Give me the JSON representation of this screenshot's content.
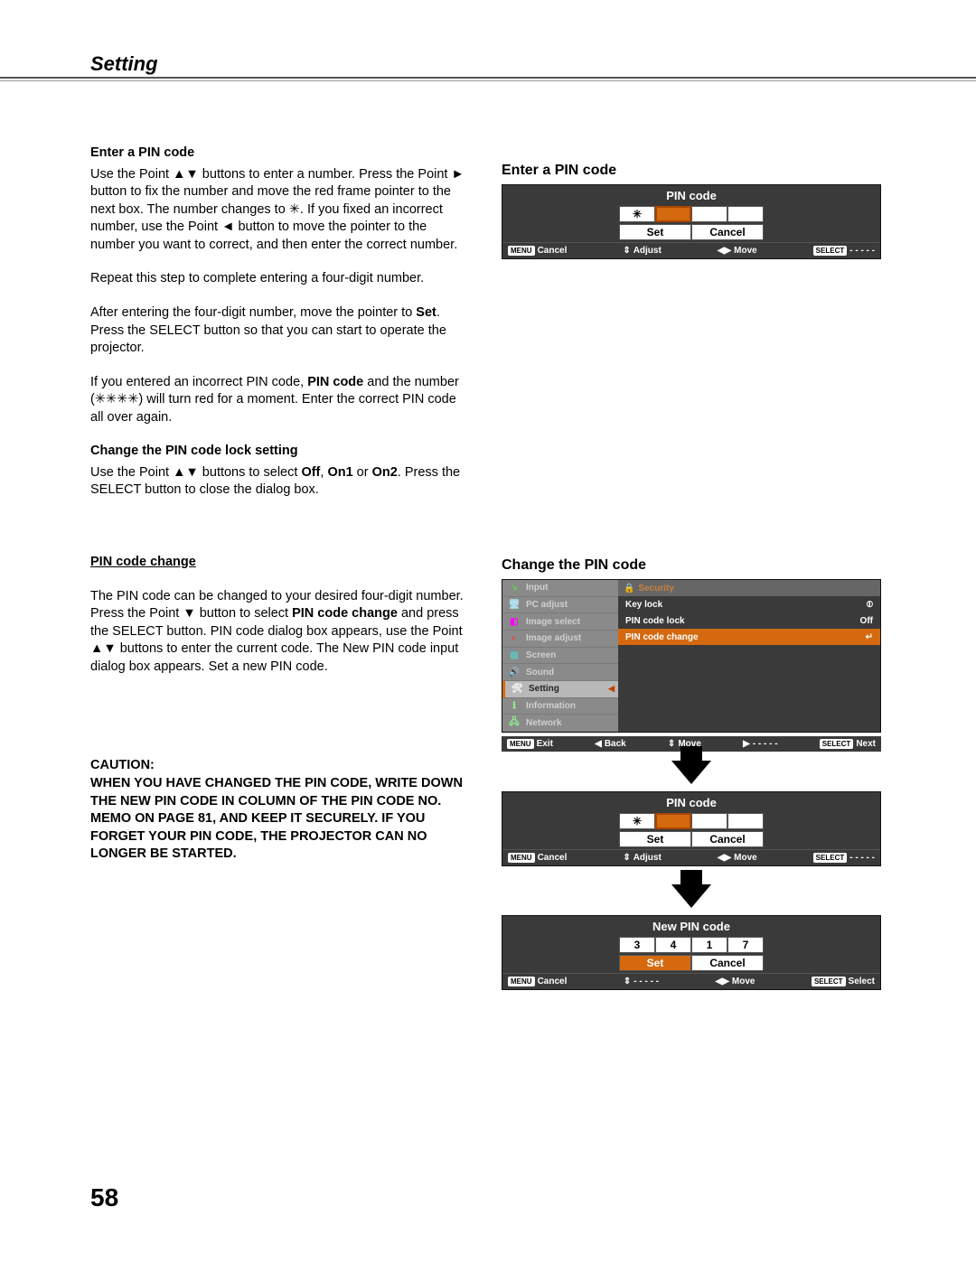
{
  "page": {
    "title": "Setting",
    "number": "58"
  },
  "left": {
    "h1": "Enter a PIN code",
    "p1": "Use the Point ▲▼ buttons to enter a number. Press the Point ► button to fix the number and move the red frame pointer to the next box. The number changes to ✳. If you fixed an incorrect number, use the Point ◄ button to move the pointer to the number you want to correct, and then enter the correct number.",
    "p2": "Repeat this step to complete entering a four-digit number.",
    "p3a": "After entering the four-digit number, move the pointer to ",
    "p3b": "Set",
    "p3c": ". Press the SELECT button so that you can start to operate the projector.",
    "p4a": "If you entered an incorrect PIN code, ",
    "p4b": "PIN code",
    "p4c": " and the number (✳✳✳✳) will turn red for a moment. Enter the correct PIN code all over again.",
    "h2": "Change the PIN code lock setting",
    "p5a": "Use the Point ▲▼ buttons to select ",
    "p5b": "Off",
    "p5c": ", ",
    "p5d": "On1",
    "p5e": " or ",
    "p5f": "On2",
    "p5g": ". Press the SELECT button to close the dialog box.",
    "h3": "PIN code change",
    "p6a": "The PIN code can be changed to your desired four-digit number. Press the Point ▼ button to select ",
    "p6b": "PIN code change",
    "p6c": " and press the SELECT button. PIN code dialog box appears, use the Point ▲▼ buttons to enter the current code. The New PIN code input dialog box appears. Set a new PIN code.",
    "caution_label": "CAUTION:",
    "caution_body": "WHEN YOU HAVE CHANGED THE PIN CODE, WRITE DOWN THE NEW PIN CODE IN COLUMN OF THE PIN CODE NO. MEMO ON PAGE 81, AND KEEP IT SECURELY. IF YOU FORGET YOUR PIN CODE, THE PROJECTOR CAN NO LONGER BE STARTED."
  },
  "right": {
    "title1": "Enter a PIN code",
    "title2": "Change the PIN code"
  },
  "osd_pin": {
    "title": "PIN code",
    "cells": [
      "✳",
      "",
      "",
      ""
    ],
    "set": "Set",
    "cancel": "Cancel",
    "footer": {
      "menu_badge": "MENU",
      "cancel": "Cancel",
      "adjust_sym": "⇕",
      "adjust": "Adjust",
      "move_sym": "◀▶",
      "move": "Move",
      "select_badge": "SELECT",
      "dashes": "- - - - -"
    }
  },
  "osd_menu": {
    "side": [
      {
        "icon": "↘",
        "cls": "ic-input",
        "label": "Input"
      },
      {
        "icon": "🖥",
        "cls": "ic-pc",
        "label": "PC adjust"
      },
      {
        "icon": "◧",
        "cls": "ic-imgsel",
        "label": "Image select"
      },
      {
        "icon": "◐",
        "cls": "ic-imgadj",
        "label": "Image adjust"
      },
      {
        "icon": "▦",
        "cls": "ic-screen",
        "label": "Screen"
      },
      {
        "icon": "🔊",
        "cls": "ic-sound",
        "label": "Sound"
      },
      {
        "icon": "🛠",
        "cls": "ic-setting",
        "label": "Setting",
        "active": true
      },
      {
        "icon": "ℹ",
        "cls": "ic-info",
        "label": "Information"
      },
      {
        "icon": "🖧",
        "cls": "ic-net",
        "label": "Network"
      }
    ],
    "header_icon": "🔒",
    "header": "Security",
    "lines": [
      {
        "label": "Key lock",
        "value": "⦶"
      },
      {
        "label": "PIN code lock",
        "value": "Off"
      },
      {
        "label": "PIN code change",
        "value": "↵",
        "sel": true
      }
    ],
    "footer": {
      "menu_badge": "MENU",
      "exit": "Exit",
      "back_sym": "◀",
      "back": "Back",
      "move_sym": "⇕",
      "move": "Move",
      "fwd_sym": "▶",
      "fwd": "- - - - -",
      "select_badge": "SELECT",
      "next": "Next"
    }
  },
  "osd_pin2": {
    "title": "PIN code",
    "cells": [
      "✳",
      "",
      "",
      ""
    ],
    "set": "Set",
    "cancel": "Cancel",
    "footer": {
      "menu_badge": "MENU",
      "cancel": "Cancel",
      "adjust_sym": "⇕",
      "adjust": "Adjust",
      "move_sym": "◀▶",
      "move": "Move",
      "select_badge": "SELECT",
      "dashes": "- - - - -"
    }
  },
  "osd_newpin": {
    "title": "New PIN code",
    "cells": [
      "3",
      "4",
      "1",
      "7"
    ],
    "set": "Set",
    "cancel": "Cancel",
    "footer": {
      "menu_badge": "MENU",
      "cancel": "Cancel",
      "adjust_sym": "⇕",
      "adjust": "- - - - -",
      "move_sym": "◀▶",
      "move": "Move",
      "select_badge": "SELECT",
      "select": "Select"
    }
  }
}
